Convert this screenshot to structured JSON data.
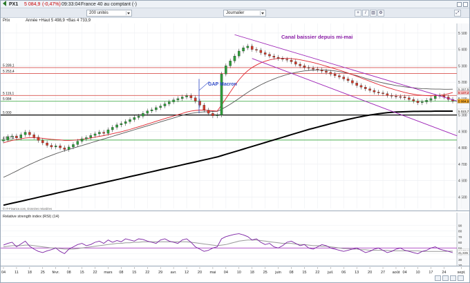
{
  "header": {
    "symbol_label": "PX1",
    "quote": "5 084,9",
    "change": "(-0,47%)",
    "timestamp": "09:33:04",
    "market": "France 40 au comptant (-)"
  },
  "toolbar": {
    "units_select": "200 unités",
    "period_select": "Journalier"
  },
  "info": {
    "label": "Prix",
    "ohlc": "Année +Haut 5 498,9 +Bas 4 733,9"
  },
  "source": "© IT-Finance.com, Données retardées",
  "chart_data": [
    {
      "type": "candlestick",
      "title": "Canal baissier depuis mi-mai",
      "annotations": [
        "Canal baissier depuis mi-mai",
        "GAP Macron"
      ],
      "ylim": [
        4430,
        5550
      ],
      "y_ticks": [
        4500,
        4600,
        4700,
        4800,
        4900,
        5000,
        5100,
        5200,
        5300,
        5400,
        5500
      ],
      "y_tick_labels": [
        "4 500",
        "4 600",
        "4 700",
        "4 800",
        "4 900",
        "5 000",
        "5 100",
        "5 200",
        "5 300",
        "5 400",
        "5 500"
      ],
      "horizontal_levels": [
        {
          "value": 5289.1,
          "label": "5 289,1",
          "color": "#d9534f"
        },
        {
          "value": 5253.4,
          "label": "5 253,4",
          "color": "#d9534f"
        },
        {
          "value": 5119.1,
          "label": "5 119,1",
          "color": "#d9534f"
        },
        {
          "value": 5084,
          "label": "5 084",
          "color": "#4caf50"
        },
        {
          "value": 5000,
          "label": "5 000",
          "color": "#000000"
        },
        {
          "value": 4847.4,
          "label": "4 847,4",
          "color": "#4caf50"
        }
      ],
      "right_tags": [
        {
          "value": 5157.5,
          "label": "5 157,5",
          "bg": "#ffffff",
          "fg": "#333333"
        },
        {
          "value": 5137.2,
          "label": "5 137,2",
          "bg": "#f4c2c2",
          "fg": "#b00000"
        },
        {
          "value": 5084.9,
          "label": "5 084,9",
          "bg": "#f5a623",
          "fg": "#000000"
        },
        {
          "value": 5023.7,
          "label": "5 023,7",
          "bg": "#ffffff",
          "fg": "#000000"
        }
      ],
      "series": [
        {
          "name": "close",
          "color": "#000000",
          "values": [
            4850,
            4868,
            4872,
            4860,
            4880,
            4895,
            4880,
            4865,
            4845,
            4830,
            4815,
            4805,
            4812,
            4800,
            4790,
            4805,
            4820,
            4840,
            4855,
            4862,
            4875,
            4885,
            4895,
            4888,
            4910,
            4925,
            4940,
            4948,
            4960,
            4972,
            4985,
            4993,
            5010,
            5025,
            5032,
            5045,
            5055,
            5068,
            5080,
            5092,
            5100,
            5110,
            5118,
            5105,
            5085,
            5060,
            5030,
            5010,
            4995,
            5000,
            5250,
            5300,
            5330,
            5360,
            5390,
            5410,
            5420,
            5400,
            5395,
            5380,
            5370,
            5360,
            5352,
            5345,
            5340,
            5335,
            5325,
            5310,
            5300,
            5290,
            5285,
            5280,
            5275,
            5268,
            5260,
            5250,
            5240,
            5232,
            5220,
            5210,
            5195,
            5180,
            5170,
            5160,
            5150,
            5140,
            5135,
            5130,
            5120,
            5115,
            5112,
            5110,
            5105,
            5095,
            5085,
            5075,
            5080,
            5090,
            5100,
            5115,
            5120,
            5110,
            5095,
            5084.9
          ]
        },
        {
          "name": "MA rouge",
          "color": "#e0242e",
          "values": [
            4830,
            4838,
            4845,
            4850,
            4855,
            4860,
            4862,
            4862,
            4860,
            4858,
            4855,
            4852,
            4850,
            4848,
            4845,
            4845,
            4846,
            4848,
            4852,
            4856,
            4860,
            4865,
            4870,
            4874,
            4880,
            4886,
            4892,
            4898,
            4905,
            4912,
            4920,
            4928,
            4936,
            4945,
            4953,
            4962,
            4970,
            4978,
            4986,
            4994,
            5002,
            5010,
            5018,
            5024,
            5028,
            5030,
            5030,
            5028,
            5026,
            5024,
            5060,
            5100,
            5140,
            5180,
            5215,
            5245,
            5270,
            5290,
            5305,
            5318,
            5328,
            5336,
            5342,
            5345,
            5346,
            5346,
            5344,
            5341,
            5337,
            5332,
            5326,
            5320,
            5313,
            5306,
            5298,
            5290,
            5282,
            5274,
            5265,
            5256,
            5246,
            5236,
            5226,
            5216,
            5206,
            5196,
            5186,
            5177,
            5168,
            5160,
            5152,
            5145,
            5138,
            5132,
            5127,
            5123,
            5120,
            5118,
            5117,
            5118,
            5120,
            5124,
            5130,
            5137
          ]
        },
        {
          "name": "MA grise",
          "color": "#555555",
          "values": [
            4620,
            4632,
            4645,
            4658,
            4672,
            4685,
            4698,
            4710,
            4722,
            4733,
            4744,
            4754,
            4764,
            4773,
            4782,
            4790,
            4798,
            4806,
            4814,
            4822,
            4830,
            4838,
            4846,
            4854,
            4862,
            4870,
            4878,
            4886,
            4894,
            4902,
            4910,
            4918,
            4926,
            4934,
            4942,
            4950,
            4958,
            4966,
            4974,
            4982,
            4990,
            4998,
            5005,
            5010,
            5014,
            5017,
            5019,
            5020,
            5021,
            5022,
            5035,
            5050,
            5066,
            5083,
            5101,
            5120,
            5138,
            5155,
            5170,
            5184,
            5197,
            5209,
            5220,
            5230,
            5239,
            5247,
            5254,
            5260,
            5265,
            5269,
            5272,
            5274,
            5275,
            5275,
            5274,
            5272,
            5269,
            5265,
            5260,
            5254,
            5247,
            5240,
            5232,
            5224,
            5216,
            5209,
            5202,
            5196,
            5190,
            5185,
            5180,
            5176,
            5172,
            5169,
            5166,
            5163,
            5161,
            5160,
            5159,
            5158,
            5158,
            5157,
            5157,
            5157.5
          ]
        },
        {
          "name": "MA noire",
          "color": "#000000",
          "values": [
            4450,
            4456,
            4462,
            4468,
            4474,
            4480,
            4486,
            4492,
            4498,
            4504,
            4510,
            4516,
            4522,
            4528,
            4534,
            4540,
            4546,
            4552,
            4558,
            4564,
            4570,
            4576,
            4582,
            4588,
            4594,
            4600,
            4606,
            4612,
            4618,
            4624,
            4630,
            4636,
            4642,
            4648,
            4654,
            4660,
            4666,
            4672,
            4678,
            4684,
            4690,
            4696,
            4702,
            4708,
            4714,
            4720,
            4726,
            4732,
            4738,
            4744,
            4752,
            4760,
            4768,
            4776,
            4784,
            4792,
            4800,
            4808,
            4816,
            4824,
            4832,
            4840,
            4848,
            4856,
            4864,
            4872,
            4880,
            4888,
            4896,
            4904,
            4912,
            4919,
            4926,
            4933,
            4940,
            4947,
            4954,
            4961,
            4967,
            4973,
            4979,
            4985,
            4990,
            4995,
            5000,
            5004,
            5008,
            5011,
            5014,
            5016,
            5018,
            5019,
            5020,
            5021,
            5022,
            5022,
            5023,
            5023,
            5023,
            5023.5,
            5023.5,
            5023.7,
            5023.7,
            5023.7
          ]
        }
      ],
      "channel": {
        "color": "#9b1fb5",
        "upper": [
          {
            "index": 53,
            "value": 5490
          },
          {
            "index": 104,
            "value": 5085
          }
        ],
        "lower": [
          {
            "index": 57,
            "value": 5345
          },
          {
            "index": 104,
            "value": 4873
          }
        ]
      }
    },
    {
      "type": "line",
      "title": "Relative strength index (RSI) (14)",
      "ylim": [
        20,
        100
      ],
      "y_ticks": [
        20,
        30,
        40,
        50,
        60,
        70,
        80,
        90
      ],
      "y_tick_labels": [
        "20",
        "30",
        "40",
        "50",
        "60",
        "70",
        "80",
        "90"
      ],
      "right_tags": [
        {
          "value": 44.384,
          "label": "44,384",
          "bg": "#ffffff",
          "fg": "#333333"
        },
        {
          "value": 41.835,
          "label": "41,835",
          "bg": "#ffffff",
          "fg": "#333333"
        }
      ],
      "reference_level": 50,
      "series": [
        {
          "name": "RSI",
          "color": "#7a1fa2",
          "values": [
            55,
            58,
            60,
            52,
            57,
            62,
            53,
            48,
            44,
            42,
            45,
            47,
            50,
            44,
            40,
            48,
            52,
            56,
            58,
            54,
            56,
            60,
            62,
            58,
            64,
            60,
            63,
            61,
            66,
            64,
            62,
            66,
            65,
            62,
            60,
            58,
            64,
            66,
            62,
            60,
            58,
            64,
            66,
            60,
            52,
            48,
            44,
            46,
            50,
            52,
            66,
            70,
            72,
            74,
            75,
            73,
            70,
            64,
            66,
            60,
            56,
            58,
            52,
            50,
            54,
            60,
            62,
            58,
            54,
            56,
            50,
            48,
            52,
            56,
            54,
            50,
            48,
            46,
            44,
            46,
            48,
            50,
            46,
            42,
            44,
            48,
            50,
            46,
            42,
            44,
            48,
            50,
            46,
            44,
            42,
            40,
            44,
            46,
            50,
            52,
            48,
            46,
            44,
            41.8
          ]
        },
        {
          "name": "MA RSI",
          "color": "#999999",
          "values": [
            52,
            53,
            54,
            54,
            54,
            55,
            55,
            54,
            53,
            52,
            51,
            50,
            50,
            49,
            48,
            48,
            48,
            49,
            50,
            51,
            52,
            53,
            54,
            55,
            56,
            57,
            58,
            58,
            59,
            59,
            60,
            60,
            61,
            61,
            61,
            61,
            61,
            61,
            61,
            61,
            61,
            61,
            61,
            60,
            59,
            58,
            57,
            56,
            55,
            54,
            55,
            56,
            58,
            60,
            62,
            63,
            64,
            64,
            64,
            63,
            62,
            61,
            60,
            59,
            58,
            58,
            58,
            57,
            56,
            56,
            55,
            54,
            54,
            53,
            53,
            52,
            51,
            50,
            49,
            49,
            48,
            48,
            47,
            47,
            46,
            46,
            46,
            46,
            46,
            45,
            45,
            45,
            45,
            45,
            45,
            45,
            44,
            44,
            44,
            44,
            44,
            44,
            44.4,
            44.4
          ]
        }
      ]
    }
  ],
  "x_axis": {
    "labels": [
      "04",
      "11",
      "18",
      "25",
      "févr.",
      "08",
      "15",
      "22",
      "mars",
      "08",
      "15",
      "22",
      "29",
      "avr.",
      "12",
      "20",
      "mai",
      "04",
      "10",
      "18",
      "25",
      "juin",
      "08",
      "15",
      "22",
      "juil.",
      "06",
      "13",
      "20",
      "27",
      "août",
      "04",
      "10",
      "17",
      "24",
      "sept.",
      "07",
      "14"
    ],
    "positions": [
      0,
      3,
      6,
      9,
      12,
      15,
      18,
      21,
      24,
      27,
      30,
      33,
      36,
      39,
      42,
      45,
      48,
      51,
      54,
      57,
      60,
      63,
      66,
      69,
      72,
      75,
      78,
      81,
      84,
      87,
      90,
      92,
      95,
      98,
      101,
      105,
      108,
      111
    ]
  },
  "icons": [
    "home-arrow-icon",
    "caret-down-icon",
    "zoom-icon",
    "draw-icon",
    "settings-icon",
    "fullscreen-icon"
  ]
}
